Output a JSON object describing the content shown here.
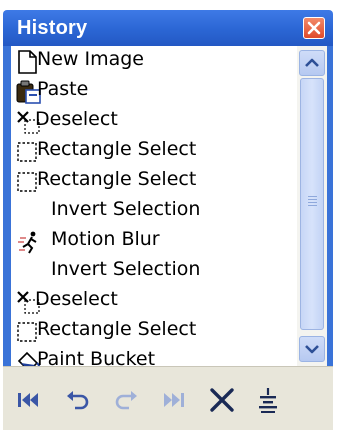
{
  "window": {
    "title": "History"
  },
  "history": [
    {
      "label": "New Image",
      "icon": "new-image-icon"
    },
    {
      "label": "Paste",
      "icon": "paste-icon"
    },
    {
      "label": "Deselect",
      "icon": "deselect-icon"
    },
    {
      "label": "Rectangle Select",
      "icon": "rectangle-select-icon"
    },
    {
      "label": "Rectangle Select",
      "icon": "rectangle-select-icon"
    },
    {
      "label": "Invert Selection",
      "icon": ""
    },
    {
      "label": "Motion Blur",
      "icon": "motion-blur-icon"
    },
    {
      "label": "Invert Selection",
      "icon": ""
    },
    {
      "label": "Deselect",
      "icon": "deselect-icon"
    },
    {
      "label": "Rectangle Select",
      "icon": "rectangle-select-icon"
    },
    {
      "label": "Paint Bucket",
      "icon": "paint-bucket-icon"
    }
  ],
  "toolbar": {
    "buttons": [
      "rewind-icon",
      "undo-icon",
      "redo-icon",
      "fast-forward-icon",
      "clear-history-icon",
      "flatten-icon"
    ]
  },
  "colors": {
    "title_bar": "#2b66d4",
    "close_button": "#e04a2a",
    "toolbar_icon": "#3a56a6",
    "toolbar_icon_disabled": "#9fb0d8"
  }
}
